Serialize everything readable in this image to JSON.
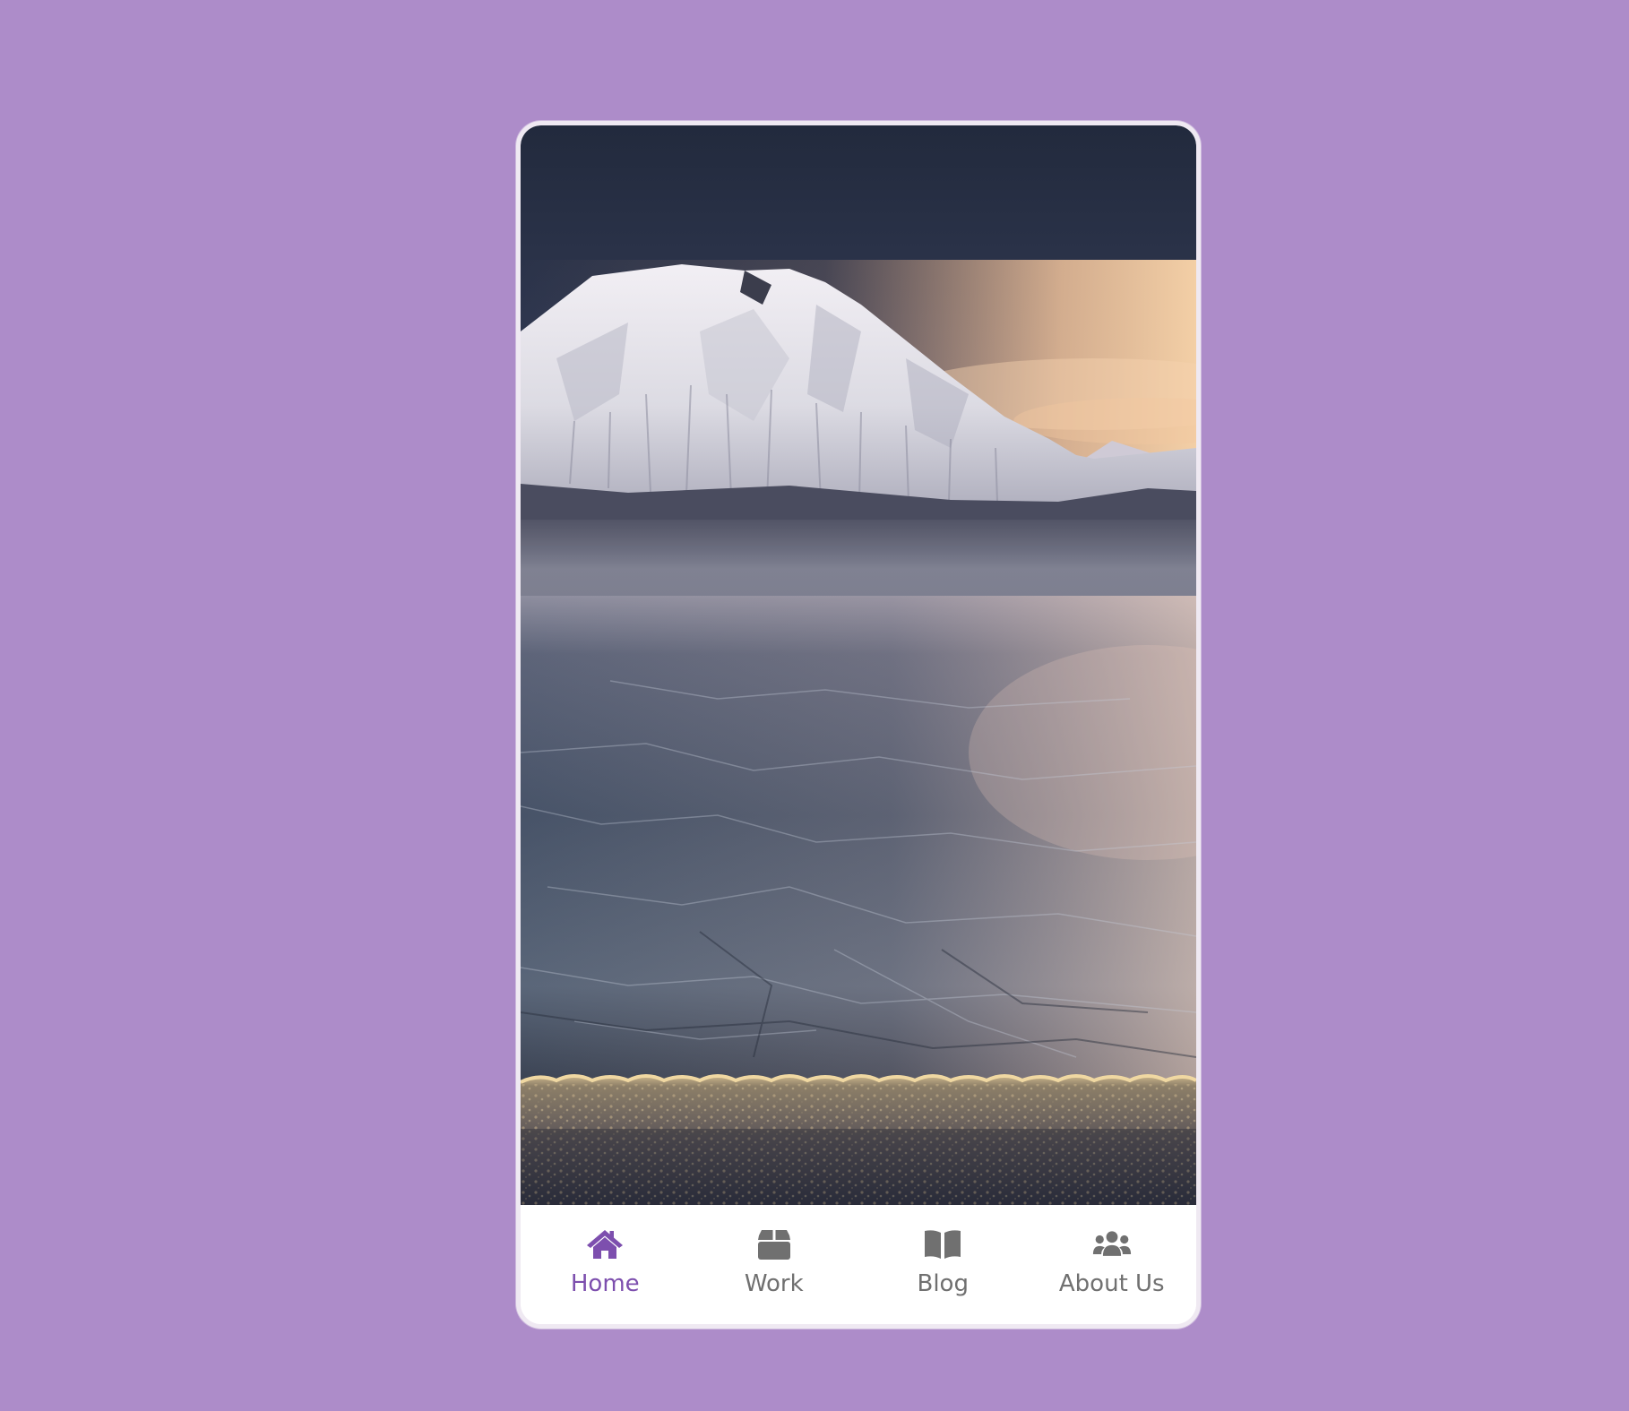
{
  "app": {
    "background_color": "#ad8cc9",
    "accent_color": "#7d4fae",
    "inactive_color": "#707070"
  },
  "hero": {
    "image": "snowy-mountain-frozen-lake-landscape"
  },
  "nav": {
    "items": [
      {
        "label": "Home",
        "icon": "home-icon",
        "active": true
      },
      {
        "label": "Work",
        "icon": "box-icon",
        "active": false
      },
      {
        "label": "Blog",
        "icon": "open-book-icon",
        "active": false
      },
      {
        "label": "About Us",
        "icon": "users-icon",
        "active": false
      }
    ]
  }
}
